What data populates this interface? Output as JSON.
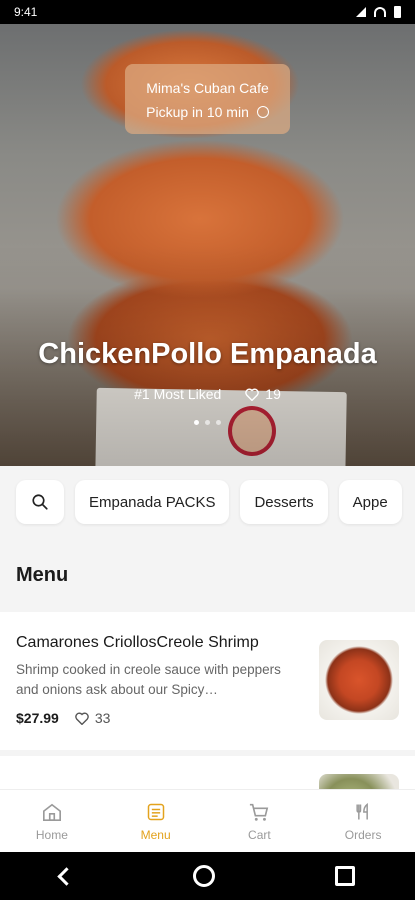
{
  "status_bar": {
    "time": "9:41"
  },
  "restaurant": {
    "name": "Mima's Cuban Cafe",
    "pickup": "Pickup in 10 min"
  },
  "featured": {
    "title": "ChickenPollo Empanada",
    "badge": "#1 Most Liked",
    "likes": "19",
    "slide_count": 3,
    "active_slide": 0
  },
  "categories": [
    "Empanada PACKS",
    "Desserts",
    "Appe"
  ],
  "menu": {
    "heading": "Menu",
    "items": [
      {
        "name": "Camarones CriollosCreole Shrimp",
        "description": "Shrimp cooked in creole sauce with peppers and onions ask about our Spicy…",
        "price": "$27.99",
        "likes": "33"
      }
    ]
  },
  "tabs": [
    {
      "label": "Home",
      "icon": "home-icon"
    },
    {
      "label": "Menu",
      "icon": "menu-icon",
      "active": true
    },
    {
      "label": "Cart",
      "icon": "cart-icon"
    },
    {
      "label": "Orders",
      "icon": "fork-knife-icon"
    }
  ],
  "colors": {
    "accent": "#e3a21d"
  }
}
